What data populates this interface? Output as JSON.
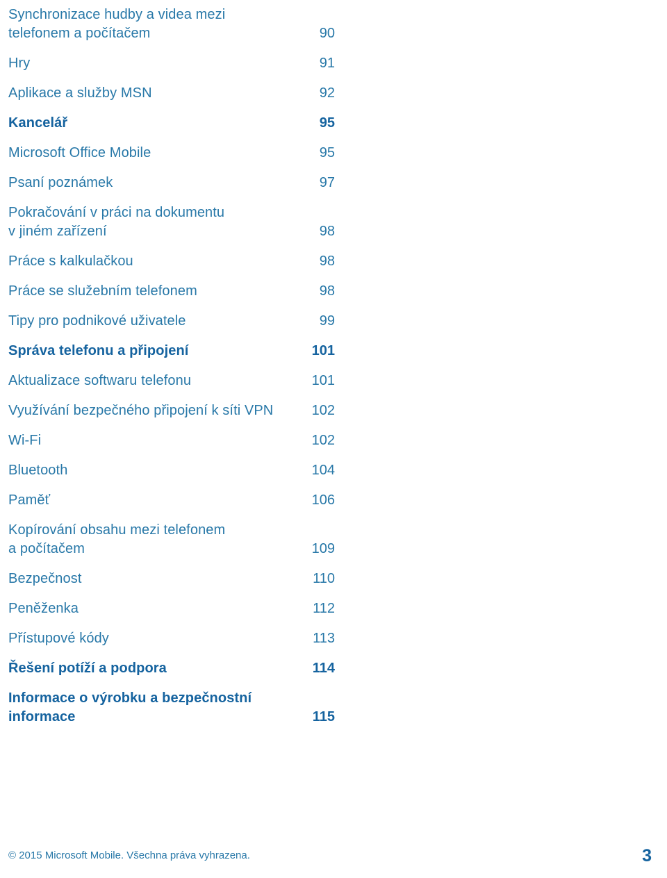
{
  "document": {
    "type": "table-of-contents",
    "language": "cs",
    "colors": {
      "entry_text": "#2878a8",
      "heading_text": "#15639f",
      "background": "#ffffff"
    }
  },
  "toc": {
    "entries": [
      {
        "label": "Synchronizace hudby a videa mezi\ntelefonem a počítačem",
        "page": "90",
        "heading": false
      },
      {
        "label": "Hry",
        "page": "91",
        "heading": false
      },
      {
        "label": "Aplikace a služby MSN",
        "page": "92",
        "heading": false
      },
      {
        "label": "Kancelář",
        "page": "95",
        "heading": true
      },
      {
        "label": "Microsoft Office Mobile",
        "page": "95",
        "heading": false
      },
      {
        "label": "Psaní poznámek",
        "page": "97",
        "heading": false
      },
      {
        "label": "Pokračování v práci na dokumentu\nv jiném zařízení",
        "page": "98",
        "heading": false
      },
      {
        "label": "Práce s kalkulačkou",
        "page": "98",
        "heading": false
      },
      {
        "label": "Práce se služebním telefonem",
        "page": "98",
        "heading": false
      },
      {
        "label": "Tipy pro podnikové uživatele",
        "page": "99",
        "heading": false
      },
      {
        "label": "Správa telefonu a připojení",
        "page": "101",
        "heading": true
      },
      {
        "label": "Aktualizace softwaru telefonu",
        "page": "101",
        "heading": false
      },
      {
        "label": "Využívání bezpečného připojení k síti VPN",
        "page": "102",
        "heading": false
      },
      {
        "label": "Wi-Fi",
        "page": "102",
        "heading": false
      },
      {
        "label": "Bluetooth",
        "page": "104",
        "heading": false
      },
      {
        "label": "Paměť",
        "page": "106",
        "heading": false
      },
      {
        "label": "Kopírování obsahu mezi telefonem\na počítačem",
        "page": "109",
        "heading": false
      },
      {
        "label": "Bezpečnost",
        "page": "110",
        "heading": false
      },
      {
        "label": "Peněženka",
        "page": "112",
        "heading": false
      },
      {
        "label": "Přístupové kódy",
        "page": "113",
        "heading": false
      },
      {
        "label": "Řešení potíží a podpora",
        "page": "114",
        "heading": true
      },
      {
        "label": "Informace o výrobku a bezpečnostní\ninformace",
        "page": "115",
        "heading": true
      }
    ]
  },
  "footer": {
    "copyright": "© 2015 Microsoft Mobile. Všechna práva vyhrazena.",
    "page_number": "3"
  }
}
